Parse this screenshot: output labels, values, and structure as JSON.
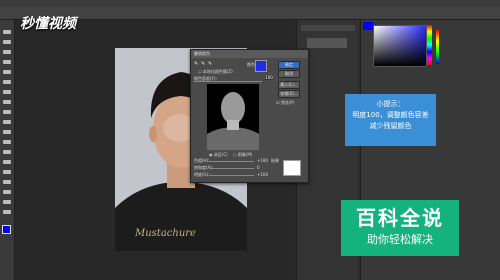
{
  "dialog": {
    "title": "替换颜色",
    "ok_label": "确定",
    "cancel_label": "取消",
    "load_label": "载入(L)...",
    "save_label": "存储(S)...",
    "preview_label": "预览(P)",
    "localized_label": "本地化颜色簇(Z)",
    "color_label": "颜色:",
    "color_tolerance_label": "颜色容差(F):",
    "color_tolerance_value": "100",
    "selection_label": "选区(C)",
    "image_label": "图像(M)",
    "hue_label": "色相(H):",
    "hue_value": "+180",
    "saturation_label": "饱和度(A):",
    "saturation_value": "0",
    "lightness_label": "明度(G):",
    "lightness_value": "+100",
    "result_label": "结果",
    "pick_color": "#1f2fe0",
    "result_color": "#ffffff"
  },
  "tip": {
    "title": "小提示：",
    "line1": "明度100，调整颜色容差",
    "line2": "减少残留颜色"
  },
  "watermark": {
    "brand": "秒懂视频",
    "title": "百科全说",
    "subtitle": "助你轻松解决"
  },
  "photo": {
    "shirt_text": "Mustachure"
  },
  "colors": {
    "accent_blue": "#3b8fd6",
    "watermark_green": "#14b37d",
    "foreground": "#0000ff"
  }
}
